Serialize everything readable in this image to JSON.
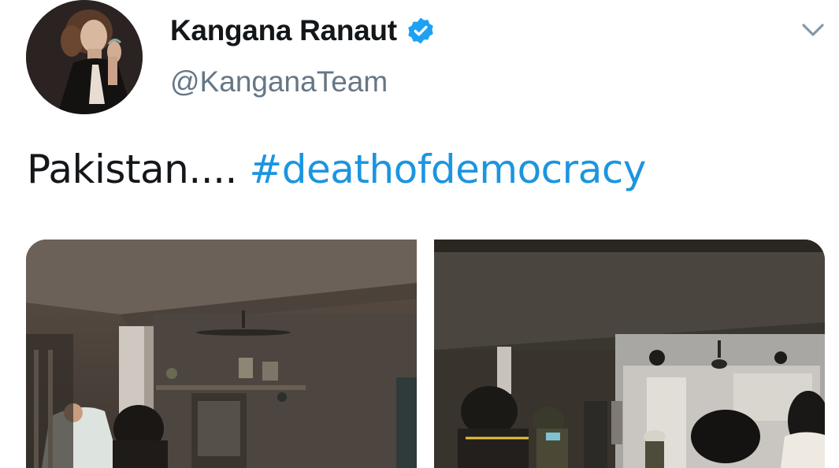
{
  "tweet": {
    "author": {
      "display_name": "Kangana Ranaut",
      "handle": "@KanganaTeam",
      "verified": true
    },
    "text_plain": "Pakistan.... ",
    "hashtag": "#deathofdemocracy",
    "media_count": 2
  },
  "icons": {
    "verified": "verified-badge-icon",
    "menu": "chevron-down-icon"
  },
  "colors": {
    "link": "#1b95e0",
    "verified": "#1da1f2",
    "secondary_text": "#657786",
    "primary_text": "#14171a"
  }
}
